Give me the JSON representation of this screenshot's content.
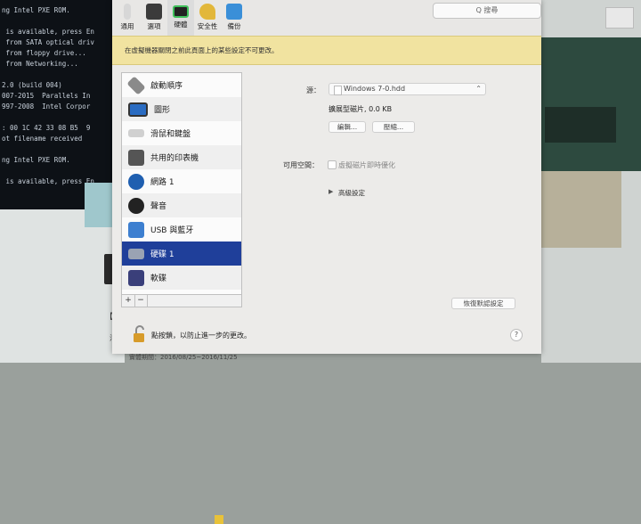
{
  "background": {
    "terminal_lines": [
      "ng Intel PXE ROM.",
      "",
      " is available, press En",
      " from SATA optical driv",
      " from floppy drive...",
      " from Networking...",
      "",
      "2.0 (build 004)",
      "007-2015  Parallels In",
      "997-2008  Intel Corpor",
      "",
      ": 00 1C 42 33 08 B5  9",
      "ot filename received",
      "",
      "ng Intel PXE ROM.",
      "",
      " is available, press En"
    ],
    "left_text_1": "【",
    "left_text_2": "活",
    "left_text_3": "實體期間：2016/08/25~2016/11/25"
  },
  "toolbar": {
    "items": [
      {
        "label": "通用",
        "icon": "general-icon"
      },
      {
        "label": "選項",
        "icon": "options-icon"
      },
      {
        "label": "硬體",
        "icon": "hardware-icon"
      },
      {
        "label": "安全性",
        "icon": "security-key-icon"
      },
      {
        "label": "備份",
        "icon": "backup-icon"
      }
    ],
    "search_placeholder": "Q 搜尋"
  },
  "banner": {
    "text": "在虛擬機器關閉之前此頁面上的某些設定不可更改。"
  },
  "sidebar": {
    "items": [
      {
        "label": "啟動順序",
        "icon": "boot-order-icon"
      },
      {
        "label": "圖形",
        "icon": "graphics-icon"
      },
      {
        "label": "滑鼠和鍵盤",
        "icon": "keyboard-icon"
      },
      {
        "label": "共用的印表機",
        "icon": "printer-icon"
      },
      {
        "label": "網路 1",
        "icon": "network-icon"
      },
      {
        "label": "聲音",
        "icon": "sound-icon"
      },
      {
        "label": "USB 與藍牙",
        "icon": "usb-bluetooth-icon"
      },
      {
        "label": "硬碟 1",
        "icon": "hard-disk-icon",
        "selected": true
      },
      {
        "label": "軟碟",
        "icon": "floppy-icon"
      }
    ],
    "add_label": "+",
    "remove_label": "−"
  },
  "disk": {
    "source_label": "源：",
    "source_value": "Windows 7-0.hdd",
    "info": "擴展型磁片, 0.0 KB",
    "edit_button": "編輯...",
    "compress_button": "壓縮...",
    "free_space_label": "可用空間：",
    "free_space_option": "虛擬磁片即時優化",
    "free_space_checked": false,
    "advanced_label": "高級設定",
    "restore_button": "恢復默認設定"
  },
  "footer": {
    "lock_text": "點按鎖，以防止進一步的更改。",
    "help_label": "?"
  }
}
